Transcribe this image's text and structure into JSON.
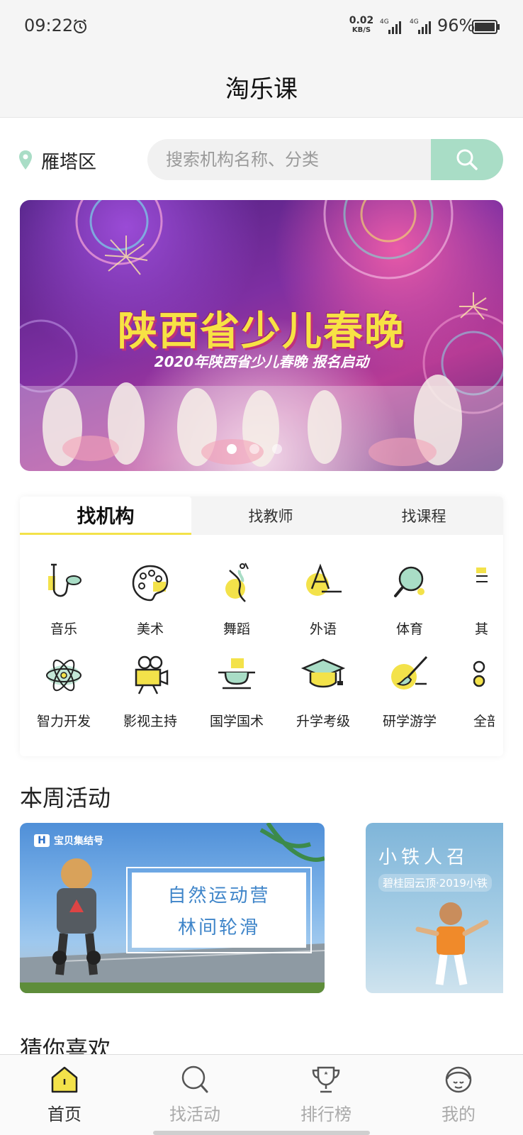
{
  "status_bar": {
    "time": "09:22",
    "net_speed_value": "0.02",
    "net_speed_unit": "KB/S",
    "signal_label": "4G",
    "battery": "96%"
  },
  "header": {
    "title": "淘乐课"
  },
  "location": {
    "label": "雁塔区"
  },
  "search": {
    "placeholder": "搜索机构名称、分类",
    "accent": "#a9ddc6"
  },
  "banner": {
    "title": "陕西省少儿春晚",
    "subtitle": "2020年陕西省少儿春晚 报名启动",
    "slide_count": 3,
    "active_slide": 1
  },
  "tabs": [
    {
      "label": "找机构",
      "active": true
    },
    {
      "label": "找教师",
      "active": false
    },
    {
      "label": "找课程",
      "active": false
    }
  ],
  "categories": [
    {
      "label": "音乐",
      "icon": "saxophone-icon"
    },
    {
      "label": "美术",
      "icon": "palette-icon"
    },
    {
      "label": "舞蹈",
      "icon": "dancer-icon"
    },
    {
      "label": "外语",
      "icon": "letter-a-icon"
    },
    {
      "label": "体育",
      "icon": "ping-pong-icon"
    },
    {
      "label": "其",
      "icon": "other-icon"
    },
    {
      "label": "智力开发",
      "icon": "atom-icon"
    },
    {
      "label": "影视主持",
      "icon": "film-camera-icon"
    },
    {
      "label": "国学国术",
      "icon": "ink-stone-icon"
    },
    {
      "label": "升学考级",
      "icon": "graduation-cap-icon"
    },
    {
      "label": "研学游学",
      "icon": "paintbrush-icon"
    },
    {
      "label": "全部",
      "icon": "all-icon"
    }
  ],
  "this_week": {
    "title": "本周活动",
    "activities": [
      {
        "logo_mark": "H",
        "logo_text": "宝贝集结号",
        "line1": "自然运动营",
        "line2": "林间轮滑"
      },
      {
        "title": "小铁人召",
        "subtitle": "碧桂园云顶·2019小铁"
      }
    ]
  },
  "guess_like": {
    "title": "猜你喜欢"
  },
  "bottom_nav": [
    {
      "label": "首页",
      "icon": "home-icon",
      "active": true
    },
    {
      "label": "找活动",
      "icon": "search-activity-icon",
      "active": false
    },
    {
      "label": "排行榜",
      "icon": "trophy-icon",
      "active": false
    },
    {
      "label": "我的",
      "icon": "profile-icon",
      "active": false
    }
  ],
  "colors": {
    "accent_yellow": "#f3e24a",
    "search_green": "#a9ddc6"
  }
}
